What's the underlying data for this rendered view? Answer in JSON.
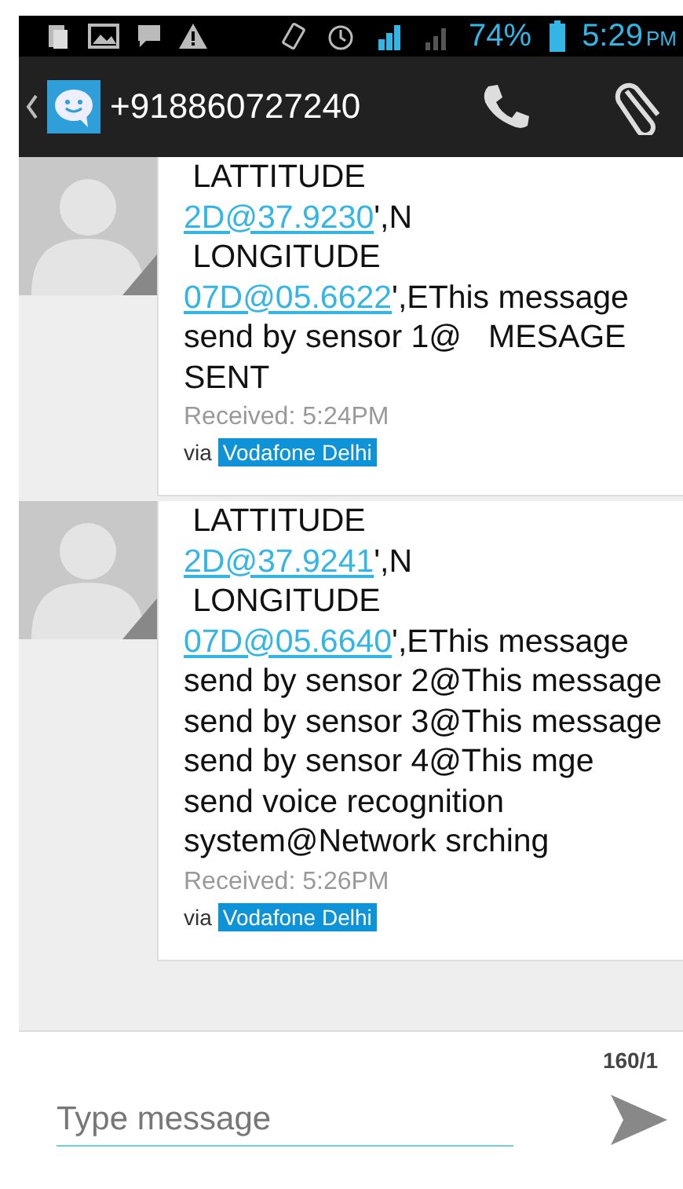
{
  "status_bar": {
    "battery": "74%",
    "time": "5:29",
    "ampm": "PM"
  },
  "action_bar": {
    "title": "+918860727240"
  },
  "messages": [
    {
      "parts": [
        {
          "kind": "plain",
          "text": " LATTITUDE\n"
        },
        {
          "kind": "link",
          "text": "2D@37.9230"
        },
        {
          "kind": "plain",
          "text": "',N\n LONGITUDE\n"
        },
        {
          "kind": "link",
          "text": "07D@05.6622"
        },
        {
          "kind": "plain",
          "text": "',EThis message send by sensor 1@   MESAGE SENT"
        }
      ],
      "received": "Received: 5:24PM",
      "via": "via",
      "carrier": "Vodafone Delhi"
    },
    {
      "parts": [
        {
          "kind": "plain",
          "text": " LATTITUDE\n"
        },
        {
          "kind": "link",
          "text": "2D@37.9241"
        },
        {
          "kind": "plain",
          "text": "',N\n LONGITUDE\n"
        },
        {
          "kind": "link",
          "text": "07D@05.6640"
        },
        {
          "kind": "plain",
          "text": "',EThis message send by sensor 2@This message send by sensor 3@This message send by sensor 4@This mge send voice recognition system@Network srching"
        }
      ],
      "received": "Received: 5:26PM",
      "via": "via",
      "carrier": "Vodafone Delhi"
    }
  ],
  "composer": {
    "counter": "160/1",
    "placeholder": "Type message"
  }
}
